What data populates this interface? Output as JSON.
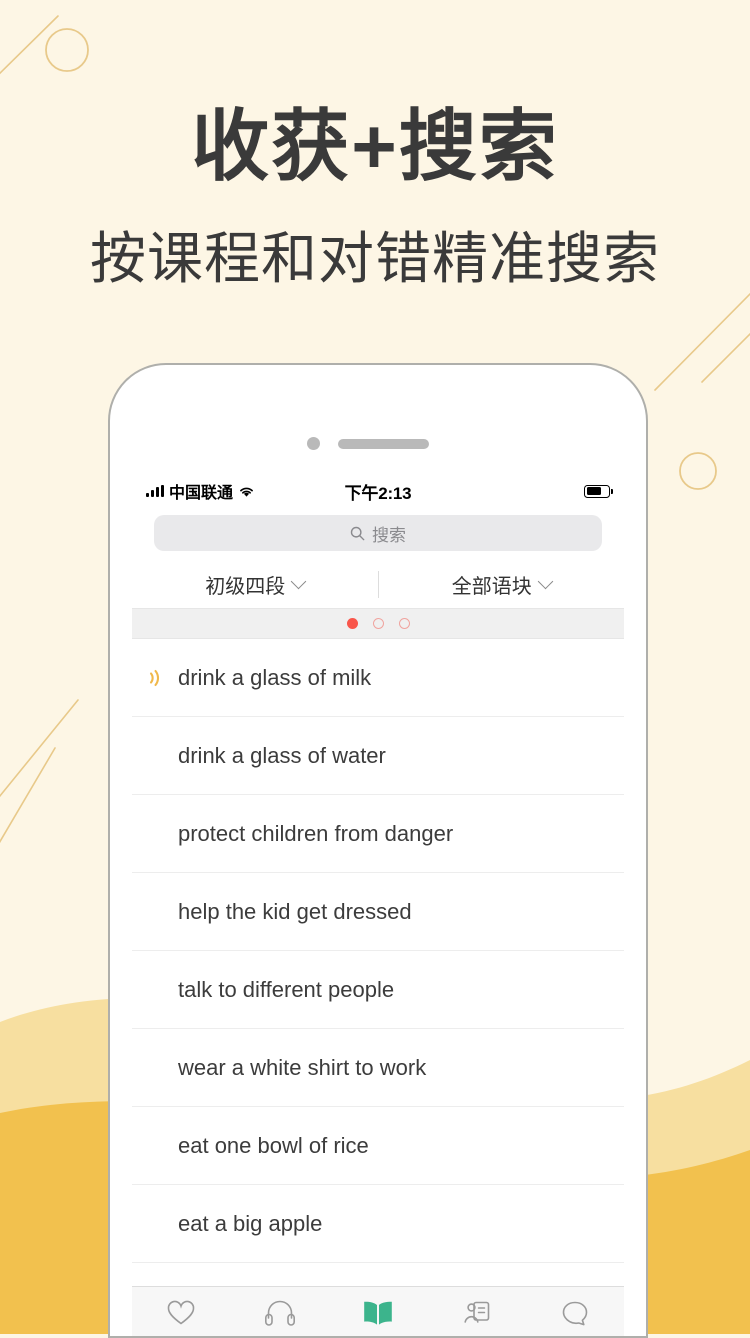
{
  "promo": {
    "title": "收获+搜索",
    "subtitle": "按课程和对错精准搜索"
  },
  "colors": {
    "background": "#FDF6E5",
    "wave_light": "#F7DFA0",
    "wave_dark": "#F2C14E",
    "deco_line": "#E8C98A",
    "accent_red": "#F9564B",
    "accent_green": "#3CB48C",
    "audio_orange": "#F0B84B",
    "text_dark": "#3A3A3A"
  },
  "phone": {
    "status_bar": {
      "carrier": "中国联通",
      "wifi_icon": "wifi-icon",
      "signal_icon": "signal-bars-icon",
      "time": "下午2:13",
      "battery_icon": "battery-icon",
      "battery_level": 60
    },
    "search": {
      "icon": "search-icon",
      "placeholder": "搜索",
      "value": ""
    },
    "filters": [
      {
        "label": "初级四段",
        "icon": "chevron-down-icon"
      },
      {
        "label": "全部语块",
        "icon": "chevron-down-icon"
      }
    ],
    "pager": {
      "total": 3,
      "active_index": 0
    },
    "list": [
      {
        "text": "drink a glass of milk",
        "audio": true
      },
      {
        "text": "drink a glass of water",
        "audio": false
      },
      {
        "text": "protect children from danger",
        "audio": false
      },
      {
        "text": "help the kid get dressed",
        "audio": false
      },
      {
        "text": "talk to different people",
        "audio": false
      },
      {
        "text": "wear a white shirt to work",
        "audio": false
      },
      {
        "text": "eat one bowl of rice",
        "audio": false
      },
      {
        "text": "eat a big apple",
        "audio": false
      }
    ],
    "tabs": [
      {
        "icon": "heart-icon",
        "active": false
      },
      {
        "icon": "headphones-icon",
        "active": false
      },
      {
        "icon": "book-icon",
        "active": true
      },
      {
        "icon": "profile-card-icon",
        "active": false
      },
      {
        "icon": "speech-bubble-icon",
        "active": false
      }
    ]
  }
}
